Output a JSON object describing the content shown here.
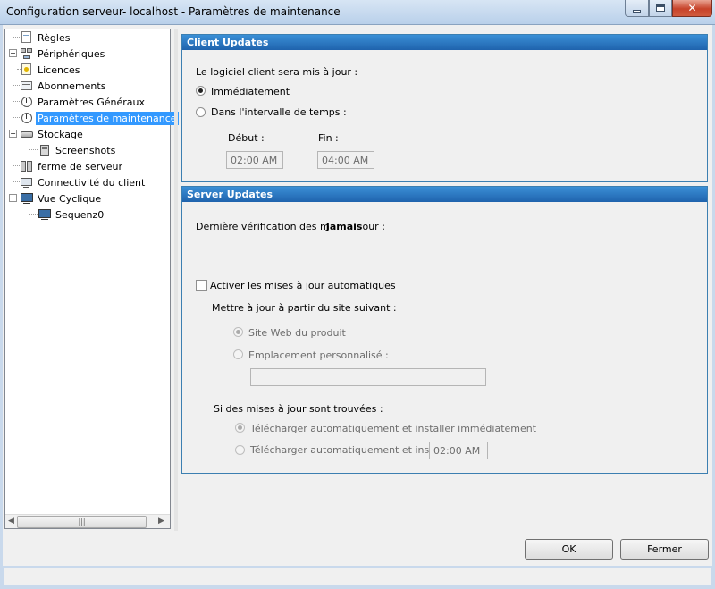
{
  "window": {
    "title": "Configuration serveur- localhost - Paramètres de maintenance"
  },
  "tree": {
    "items": [
      {
        "label": "Règles"
      },
      {
        "label": "Périphériques"
      },
      {
        "label": "Licences"
      },
      {
        "label": "Abonnements"
      },
      {
        "label": "Paramètres Généraux"
      },
      {
        "label": "Paramètres de maintenance",
        "selected": true
      },
      {
        "label": "Stockage"
      },
      {
        "label": "Screenshots"
      },
      {
        "label": "ferme de serveur"
      },
      {
        "label": "Connectivité du client"
      },
      {
        "label": "Vue Cyclique"
      },
      {
        "label": "Sequenz0"
      }
    ]
  },
  "client_updates": {
    "header": "Client Updates",
    "prompt": "Le logiciel client sera mis à jour :",
    "option_immediate": "Immédiatement",
    "option_interval": "Dans l'intervalle de temps :",
    "start_label": "Début :",
    "end_label": "Fin :",
    "start_value": "02:00 AM",
    "end_value": "04:00 AM",
    "selected": "immediate"
  },
  "server_updates": {
    "header": "Server Updates",
    "last_check_label": "Dernière vérification des m",
    "last_check_value": "Jamais",
    "last_check_label_tail": "our :",
    "auto_update_label": "Activer les mises à jour automatiques",
    "auto_update_checked": false,
    "site_prompt": "Mettre à jour à partir du site suivant :",
    "option_product_site": "Site Web du produit",
    "option_custom_location": "Emplacement personnalisé :",
    "custom_location_value": "",
    "found_prompt": "Si des mises à jour sont trouvées :",
    "option_install_now": "Télécharger automatiquement et installer immédiatement",
    "option_install_at": "Télécharger automatiquement et inst",
    "install_time": "02:00 AM"
  },
  "buttons": {
    "ok": "OK",
    "close": "Fermer"
  },
  "colors": {
    "panel_header": "#1f63ad",
    "selection": "#3399ff"
  }
}
